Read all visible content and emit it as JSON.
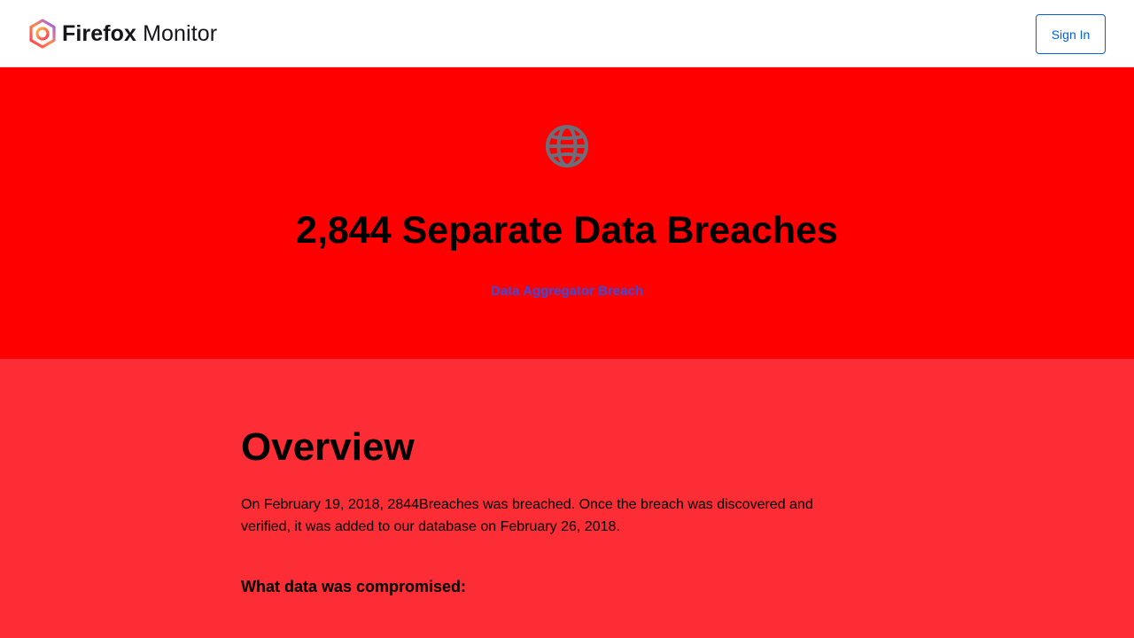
{
  "header": {
    "logo": {
      "brand": "Firefox",
      "product": "Monitor",
      "icon": "firefox-monitor-logo"
    },
    "sign_in_label": "Sign In"
  },
  "hero": {
    "icon": "globe-icon",
    "title": "2,844 Separate Data Breaches",
    "badge": "Data Aggregator Breach"
  },
  "overview": {
    "title": "Overview",
    "text": "On February 19, 2018, 2844Breaches was breached. Once the breach was discovered and verified, it was added to our database on February 26, 2018.",
    "compromised_title": "What data was compromised:"
  },
  "colors": {
    "header_bg": "#ffffff",
    "hero_bg": "#ff0000",
    "body_bg": "#fc2d34",
    "accent_blue": "#0060df",
    "badge_text": "#3a4ce0",
    "globe_icon": "#6c6f7a"
  }
}
